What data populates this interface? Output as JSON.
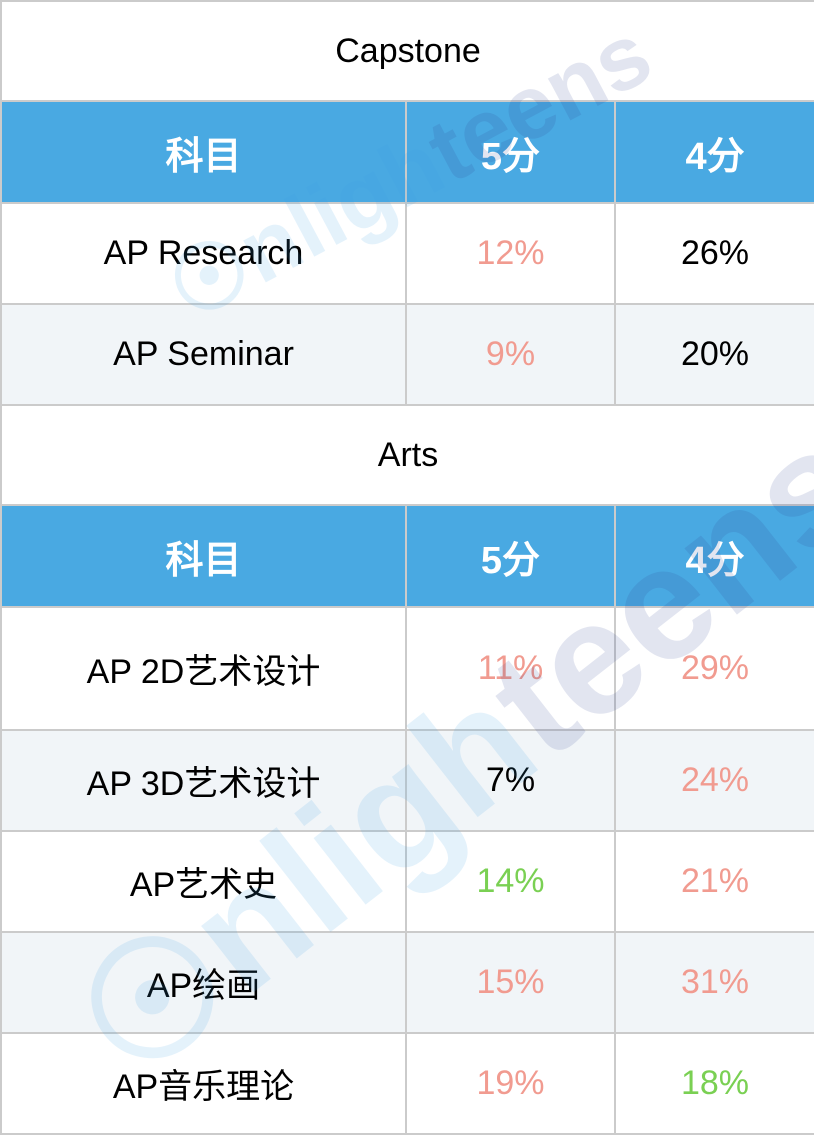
{
  "watermark": {
    "part1": "nligh",
    "part2": "teens",
    "icon": "lightbulb-e-logo-icon"
  },
  "colors": {
    "header_bg": "#49a9e2",
    "red": "#f19b90",
    "green": "#7ad053",
    "alt_row": "#eef3f7",
    "border": "#cbcbcb"
  },
  "sections": [
    {
      "title": "Capstone",
      "headers": [
        "科目",
        "5分",
        "4分"
      ],
      "rows": [
        {
          "subject": "AP Research",
          "score5": "12%",
          "score5_color": "red",
          "score4": "26%",
          "score4_color": "black"
        },
        {
          "subject": "AP Seminar",
          "score5": "9%",
          "score5_color": "red",
          "score4": "20%",
          "score4_color": "black"
        }
      ]
    },
    {
      "title": "Arts",
      "headers": [
        "科目",
        "5分",
        "4分"
      ],
      "rows": [
        {
          "subject": "AP 2D艺术设计",
          "score5": "11%",
          "score5_color": "red",
          "score4": "29%",
          "score4_color": "red"
        },
        {
          "subject": "AP 3D艺术设计",
          "score5": "7%",
          "score5_color": "black",
          "score4": "24%",
          "score4_color": "red"
        },
        {
          "subject": "AP艺术史",
          "score5": "14%",
          "score5_color": "green",
          "score4": "21%",
          "score4_color": "red"
        },
        {
          "subject": "AP绘画",
          "score5": "15%",
          "score5_color": "red",
          "score4": "31%",
          "score4_color": "red"
        },
        {
          "subject": "AP音乐理论",
          "score5": "19%",
          "score5_color": "red",
          "score4": "18%",
          "score4_color": "green"
        }
      ]
    }
  ]
}
